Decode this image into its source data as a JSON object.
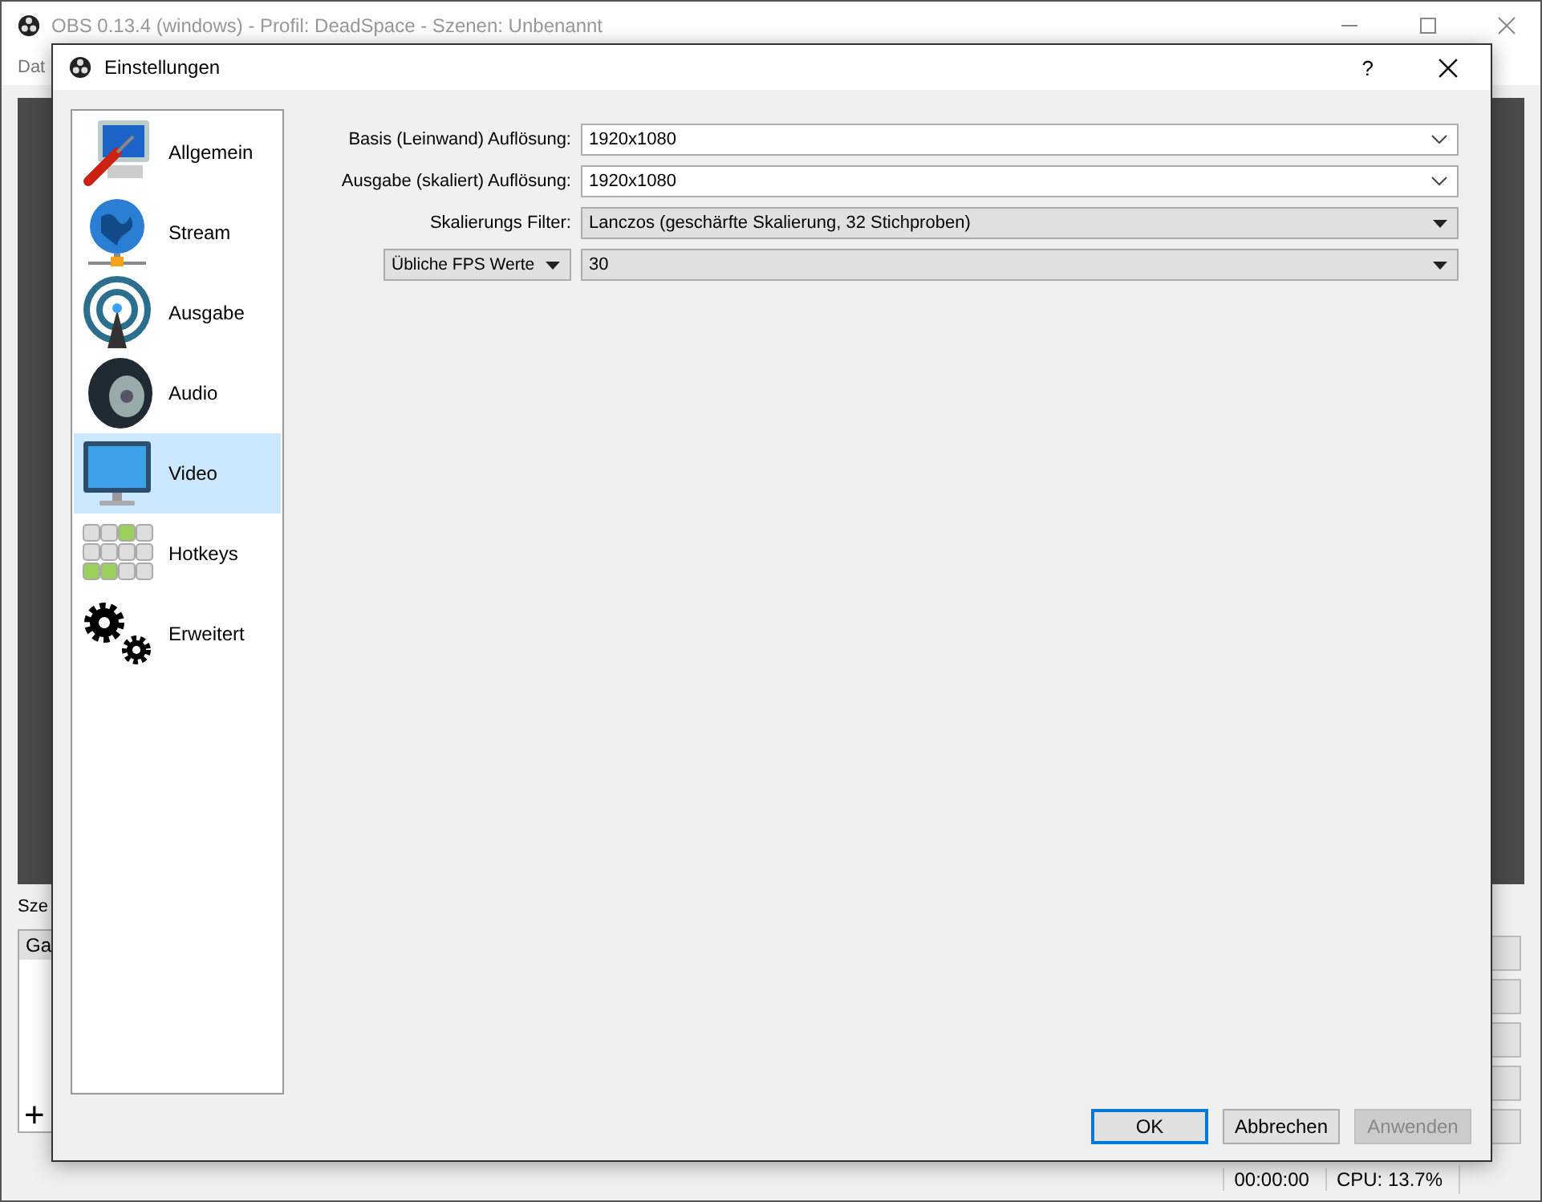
{
  "main_window": {
    "title": "OBS 0.13.4 (windows) - Profil: DeadSpace - Szenen: Unbenannt",
    "menu": [
      "Dat"
    ],
    "scenes_label": "Sze",
    "scenes": [
      {
        "label": "Ga",
        "selected": true
      }
    ],
    "add_button": "+",
    "status_bar": {
      "time": "00:00:00",
      "cpu": "CPU: 13.7%"
    }
  },
  "dialog": {
    "title": "Einstellungen",
    "help_button": "?",
    "sidebar": [
      {
        "label": "Allgemein",
        "selected": false
      },
      {
        "label": "Stream",
        "selected": false
      },
      {
        "label": "Ausgabe",
        "selected": false
      },
      {
        "label": "Audio",
        "selected": false
      },
      {
        "label": "Video",
        "selected": true
      },
      {
        "label": "Hotkeys",
        "selected": false
      },
      {
        "label": "Erweitert",
        "selected": false
      }
    ],
    "rows": [
      {
        "label": {
          "kind": "text",
          "text": "Basis (Leinwand) Auflösung:"
        },
        "kind": "editable",
        "value": "1920x1080"
      },
      {
        "label": {
          "kind": "text",
          "text": "Ausgabe (skaliert) Auflösung:"
        },
        "kind": "editable",
        "value": "1920x1080"
      },
      {
        "label": {
          "kind": "text",
          "text": "Skalierungs Filter:"
        },
        "kind": "dropdown",
        "value": "Lanczos (geschärfte Skalierung, 32 Stichproben)"
      },
      {
        "label": {
          "kind": "dropdown",
          "text": "Übliche FPS Werte"
        },
        "kind": "dropdown",
        "value": "30"
      }
    ],
    "buttons": [
      {
        "label": "OK",
        "default": true,
        "disabled": false
      },
      {
        "label": "Abbrechen",
        "default": false,
        "disabled": false
      },
      {
        "label": "Anwenden",
        "default": false,
        "disabled": true
      }
    ]
  }
}
